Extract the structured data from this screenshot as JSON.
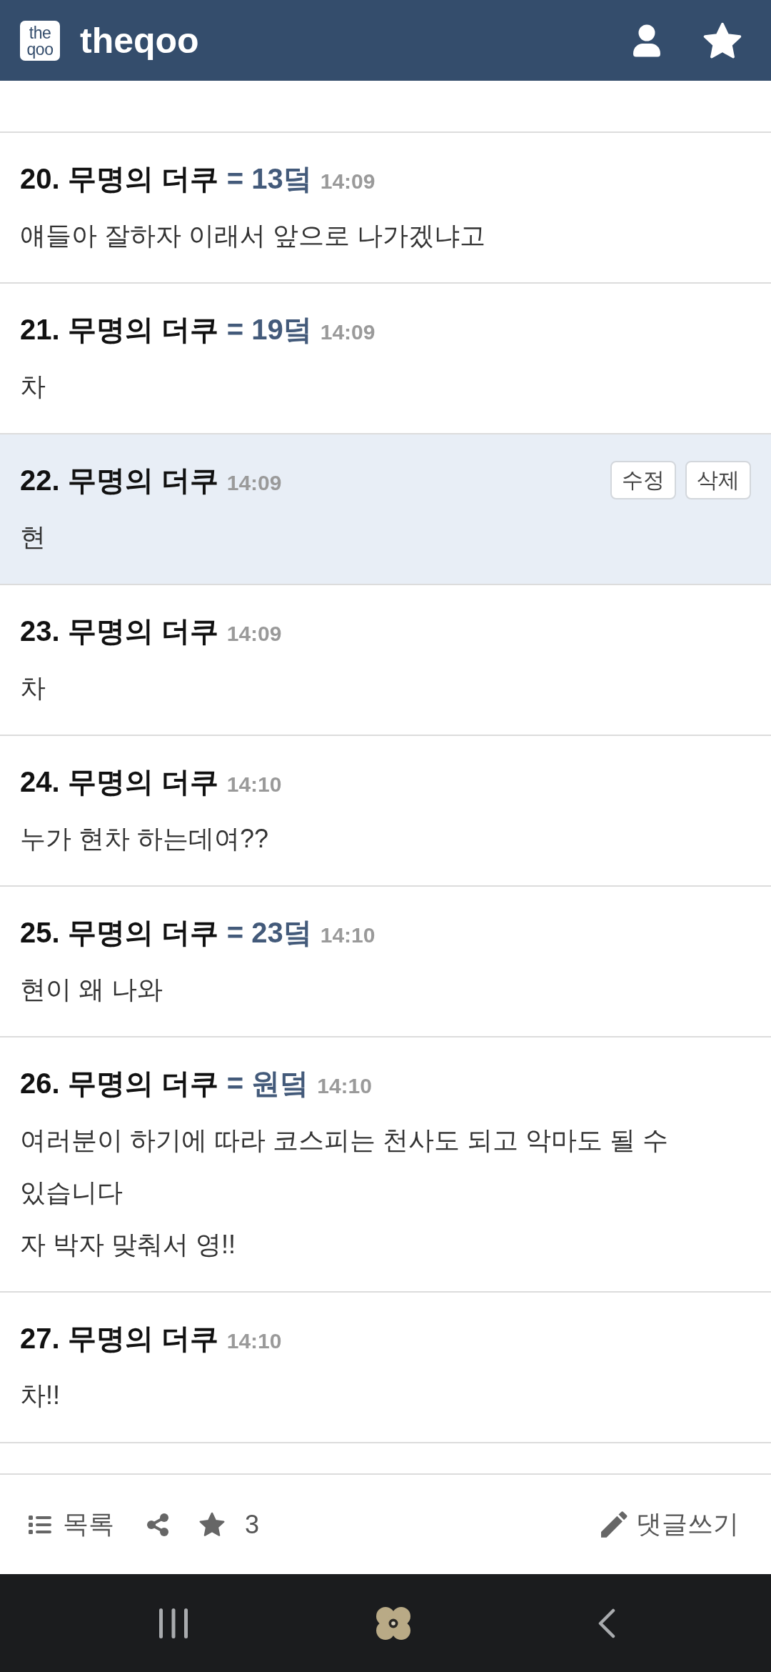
{
  "header": {
    "logo": [
      "the",
      "qoo"
    ],
    "site_name": "theqoo"
  },
  "comments": [
    {
      "number": "20.",
      "author": "무명의 더쿠",
      "reply_to": "= 13덬",
      "time": "14:09",
      "lines": [
        "얘들아 잘하자 이래서 앞으로 나가겠냐고"
      ],
      "own": false
    },
    {
      "number": "21.",
      "author": "무명의 더쿠",
      "reply_to": "= 19덬",
      "time": "14:09",
      "lines": [
        "차"
      ],
      "own": false
    },
    {
      "number": "22.",
      "author": "무명의 더쿠",
      "time": "14:09",
      "lines": [
        "현"
      ],
      "own": true,
      "actions": [
        "수정",
        "삭제"
      ]
    },
    {
      "number": "23.",
      "author": "무명의 더쿠",
      "time": "14:09",
      "lines": [
        "차"
      ],
      "own": false
    },
    {
      "number": "24.",
      "author": "무명의 더쿠",
      "time": "14:10",
      "lines": [
        "누가 현차 하는데여??"
      ],
      "own": false
    },
    {
      "number": "25.",
      "author": "무명의 더쿠",
      "reply_to": "= 23덬",
      "time": "14:10",
      "lines": [
        "현이 왜 나와"
      ],
      "own": false
    },
    {
      "number": "26.",
      "author": "무명의 더쿠",
      "reply_to": "= 원덬",
      "time": "14:10",
      "lines": [
        "여러분이 하기에 따라 코스피는 천사도 되고 악마도 될 수 있습니다",
        "자 박자 맞춰서 영!!"
      ],
      "own": false
    },
    {
      "number": "27.",
      "author": "무명의 더쿠",
      "time": "14:10",
      "lines": [
        "차!!"
      ],
      "own": false
    }
  ],
  "toolbar": {
    "list_label": "목록",
    "star_count": "3",
    "write_label": "댓글쓰기"
  }
}
